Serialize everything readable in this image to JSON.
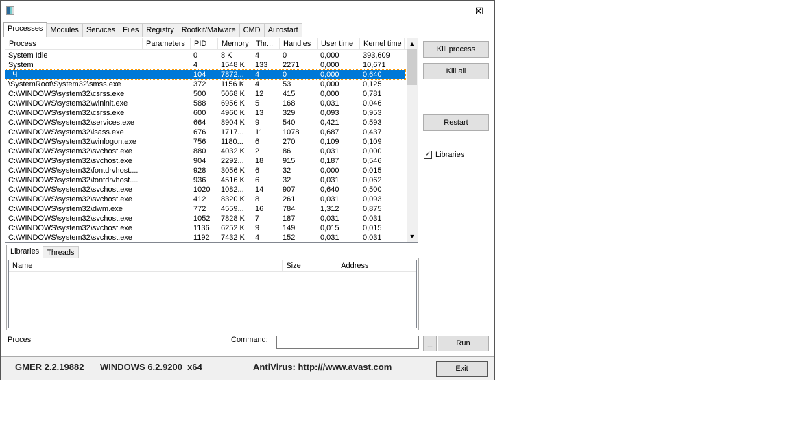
{
  "window": {
    "minimize": "–",
    "maximize": "☐",
    "close": "✕"
  },
  "tabs": [
    "Processes",
    "Modules",
    "Services",
    "Files",
    "Registry",
    "Rootkit/Malware",
    "CMD",
    "Autostart"
  ],
  "process_table": {
    "columns": [
      "Process",
      "Parameters",
      "PID",
      "Memory",
      "Thr...",
      "Handles",
      "User time",
      "Kernel time"
    ],
    "rows": [
      [
        "System Idle",
        "",
        "0",
        "8 K",
        "4",
        "0",
        "0,000",
        "393,609"
      ],
      [
        "System",
        "",
        "4",
        "1548 K",
        "133",
        "2271",
        "0,000",
        "10,671"
      ],
      [
        "  Ч",
        "",
        "104",
        "7872...",
        "4",
        "0",
        "0,000",
        "0,640"
      ],
      [
        "\\SystemRoot\\System32\\smss.exe",
        "",
        "372",
        "1156 K",
        "4",
        "53",
        "0,000",
        "0,125"
      ],
      [
        "C:\\WINDOWS\\system32\\csrss.exe",
        "",
        "500",
        "5068 K",
        "12",
        "415",
        "0,000",
        "0,781"
      ],
      [
        "C:\\WINDOWS\\system32\\wininit.exe",
        "",
        "588",
        "6956 K",
        "5",
        "168",
        "0,031",
        "0,046"
      ],
      [
        "C:\\WINDOWS\\system32\\csrss.exe",
        "",
        "600",
        "4960 K",
        "13",
        "329",
        "0,093",
        "0,953"
      ],
      [
        "C:\\WINDOWS\\system32\\services.exe",
        "",
        "664",
        "8904 K",
        "9",
        "540",
        "0,421",
        "0,593"
      ],
      [
        "C:\\WINDOWS\\system32\\lsass.exe",
        "",
        "676",
        "1717...",
        "11",
        "1078",
        "0,687",
        "0,437"
      ],
      [
        "C:\\WINDOWS\\system32\\winlogon.exe",
        "",
        "756",
        "1180...",
        "6",
        "270",
        "0,109",
        "0,109"
      ],
      [
        "C:\\WINDOWS\\system32\\svchost.exe",
        "",
        "880",
        "4032 K",
        "2",
        "86",
        "0,031",
        "0,000"
      ],
      [
        "C:\\WINDOWS\\system32\\svchost.exe",
        "",
        "904",
        "2292...",
        "18",
        "915",
        "0,187",
        "0,546"
      ],
      [
        "C:\\WINDOWS\\system32\\fontdrvhost....",
        "",
        "928",
        "3056 K",
        "6",
        "32",
        "0,000",
        "0,015"
      ],
      [
        "C:\\WINDOWS\\system32\\fontdrvhost....",
        "",
        "936",
        "4516 K",
        "6",
        "32",
        "0,031",
        "0,062"
      ],
      [
        "C:\\WINDOWS\\system32\\svchost.exe",
        "",
        "1020",
        "1082...",
        "14",
        "907",
        "0,640",
        "0,500"
      ],
      [
        "C:\\WINDOWS\\system32\\svchost.exe",
        "",
        "412",
        "8320 K",
        "8",
        "261",
        "0,031",
        "0,093"
      ],
      [
        "C:\\WINDOWS\\system32\\dwm.exe",
        "",
        "772",
        "4559...",
        "16",
        "784",
        "1,312",
        "0,875"
      ],
      [
        "C:\\WINDOWS\\system32\\svchost.exe",
        "",
        "1052",
        "7828 K",
        "7",
        "187",
        "0,031",
        "0,031"
      ],
      [
        "C:\\WINDOWS\\system32\\svchost.exe",
        "",
        "1136",
        "6252 K",
        "9",
        "149",
        "0,015",
        "0,015"
      ],
      [
        "C:\\WINDOWS\\system32\\svchost.exe",
        "",
        "1192",
        "7432 K",
        "4",
        "152",
        "0,031",
        "0,031"
      ]
    ],
    "selected_index": 2
  },
  "lower_tabs": [
    "Libraries",
    "Threads"
  ],
  "lib_table": {
    "columns": [
      "Name",
      "Size",
      "Address",
      ""
    ]
  },
  "buttons": {
    "kill_process": "Kill process",
    "kill_all": "Kill all",
    "restart": "Restart",
    "browse": "...",
    "run": "Run",
    "exit": "Exit"
  },
  "libraries_checkbox": {
    "label": "Libraries",
    "checked": true
  },
  "proces_label": "Proces",
  "command": {
    "label": "Command:",
    "value": ""
  },
  "status": {
    "version": "GMER 2.2.19882",
    "os": "WINDOWS 6.2.9200  x64",
    "antivirus": "AntiVirus: http:///www.avast.com"
  }
}
